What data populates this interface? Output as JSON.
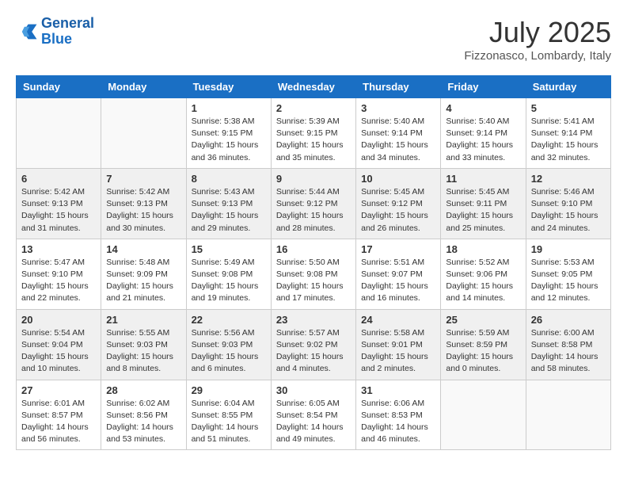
{
  "header": {
    "logo_line1": "General",
    "logo_line2": "Blue",
    "month_year": "July 2025",
    "location": "Fizzonasco, Lombardy, Italy"
  },
  "weekdays": [
    "Sunday",
    "Monday",
    "Tuesday",
    "Wednesday",
    "Thursday",
    "Friday",
    "Saturday"
  ],
  "weeks": [
    [
      {
        "day": null
      },
      {
        "day": null
      },
      {
        "day": "1",
        "sunrise": "5:38 AM",
        "sunset": "9:15 PM",
        "daylight": "15 hours and 36 minutes."
      },
      {
        "day": "2",
        "sunrise": "5:39 AM",
        "sunset": "9:15 PM",
        "daylight": "15 hours and 35 minutes."
      },
      {
        "day": "3",
        "sunrise": "5:40 AM",
        "sunset": "9:14 PM",
        "daylight": "15 hours and 34 minutes."
      },
      {
        "day": "4",
        "sunrise": "5:40 AM",
        "sunset": "9:14 PM",
        "daylight": "15 hours and 33 minutes."
      },
      {
        "day": "5",
        "sunrise": "5:41 AM",
        "sunset": "9:14 PM",
        "daylight": "15 hours and 32 minutes."
      }
    ],
    [
      {
        "day": "6",
        "sunrise": "5:42 AM",
        "sunset": "9:13 PM",
        "daylight": "15 hours and 31 minutes."
      },
      {
        "day": "7",
        "sunrise": "5:42 AM",
        "sunset": "9:13 PM",
        "daylight": "15 hours and 30 minutes."
      },
      {
        "day": "8",
        "sunrise": "5:43 AM",
        "sunset": "9:13 PM",
        "daylight": "15 hours and 29 minutes."
      },
      {
        "day": "9",
        "sunrise": "5:44 AM",
        "sunset": "9:12 PM",
        "daylight": "15 hours and 28 minutes."
      },
      {
        "day": "10",
        "sunrise": "5:45 AM",
        "sunset": "9:12 PM",
        "daylight": "15 hours and 26 minutes."
      },
      {
        "day": "11",
        "sunrise": "5:45 AM",
        "sunset": "9:11 PM",
        "daylight": "15 hours and 25 minutes."
      },
      {
        "day": "12",
        "sunrise": "5:46 AM",
        "sunset": "9:10 PM",
        "daylight": "15 hours and 24 minutes."
      }
    ],
    [
      {
        "day": "13",
        "sunrise": "5:47 AM",
        "sunset": "9:10 PM",
        "daylight": "15 hours and 22 minutes."
      },
      {
        "day": "14",
        "sunrise": "5:48 AM",
        "sunset": "9:09 PM",
        "daylight": "15 hours and 21 minutes."
      },
      {
        "day": "15",
        "sunrise": "5:49 AM",
        "sunset": "9:08 PM",
        "daylight": "15 hours and 19 minutes."
      },
      {
        "day": "16",
        "sunrise": "5:50 AM",
        "sunset": "9:08 PM",
        "daylight": "15 hours and 17 minutes."
      },
      {
        "day": "17",
        "sunrise": "5:51 AM",
        "sunset": "9:07 PM",
        "daylight": "15 hours and 16 minutes."
      },
      {
        "day": "18",
        "sunrise": "5:52 AM",
        "sunset": "9:06 PM",
        "daylight": "15 hours and 14 minutes."
      },
      {
        "day": "19",
        "sunrise": "5:53 AM",
        "sunset": "9:05 PM",
        "daylight": "15 hours and 12 minutes."
      }
    ],
    [
      {
        "day": "20",
        "sunrise": "5:54 AM",
        "sunset": "9:04 PM",
        "daylight": "15 hours and 10 minutes."
      },
      {
        "day": "21",
        "sunrise": "5:55 AM",
        "sunset": "9:03 PM",
        "daylight": "15 hours and 8 minutes."
      },
      {
        "day": "22",
        "sunrise": "5:56 AM",
        "sunset": "9:03 PM",
        "daylight": "15 hours and 6 minutes."
      },
      {
        "day": "23",
        "sunrise": "5:57 AM",
        "sunset": "9:02 PM",
        "daylight": "15 hours and 4 minutes."
      },
      {
        "day": "24",
        "sunrise": "5:58 AM",
        "sunset": "9:01 PM",
        "daylight": "15 hours and 2 minutes."
      },
      {
        "day": "25",
        "sunrise": "5:59 AM",
        "sunset": "8:59 PM",
        "daylight": "15 hours and 0 minutes."
      },
      {
        "day": "26",
        "sunrise": "6:00 AM",
        "sunset": "8:58 PM",
        "daylight": "14 hours and 58 minutes."
      }
    ],
    [
      {
        "day": "27",
        "sunrise": "6:01 AM",
        "sunset": "8:57 PM",
        "daylight": "14 hours and 56 minutes."
      },
      {
        "day": "28",
        "sunrise": "6:02 AM",
        "sunset": "8:56 PM",
        "daylight": "14 hours and 53 minutes."
      },
      {
        "day": "29",
        "sunrise": "6:04 AM",
        "sunset": "8:55 PM",
        "daylight": "14 hours and 51 minutes."
      },
      {
        "day": "30",
        "sunrise": "6:05 AM",
        "sunset": "8:54 PM",
        "daylight": "14 hours and 49 minutes."
      },
      {
        "day": "31",
        "sunrise": "6:06 AM",
        "sunset": "8:53 PM",
        "daylight": "14 hours and 46 minutes."
      },
      {
        "day": null
      },
      {
        "day": null
      }
    ]
  ],
  "labels": {
    "sunrise_prefix": "Sunrise: ",
    "sunset_prefix": "Sunset: ",
    "daylight_prefix": "Daylight: "
  }
}
